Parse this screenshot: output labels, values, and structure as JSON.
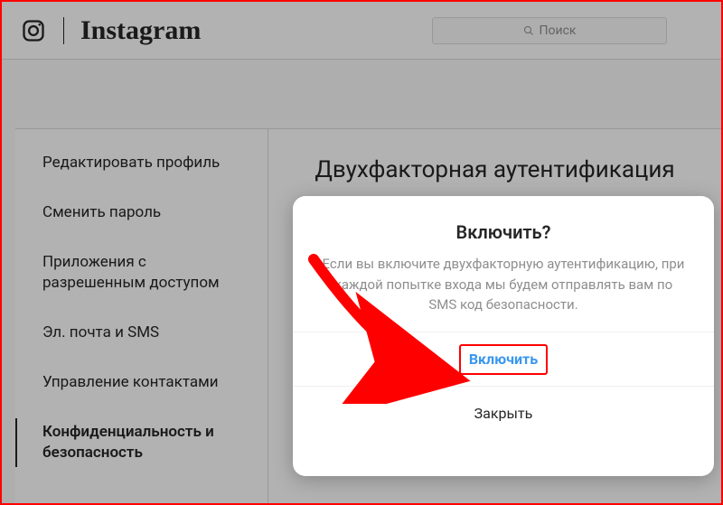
{
  "header": {
    "wordmark": "Instagram",
    "search_placeholder": "Поиск"
  },
  "sidebar": {
    "items": [
      {
        "label": "Редактировать профиль"
      },
      {
        "label": "Сменить пароль"
      },
      {
        "label": "Приложения с разрешенным доступом"
      },
      {
        "label": "Эл. почта и SMS"
      },
      {
        "label": "Управление контактами"
      },
      {
        "label": "Конфиденциальность и безопасность"
      }
    ],
    "active_index": 5
  },
  "content": {
    "page_title": "Двухфакторная аутентификация"
  },
  "modal": {
    "title": "Включить?",
    "description": "Если вы включите двухфакторную аутентификацию, при каждой попытке входа мы будем отправлять вам по SMS код безопасности.",
    "primary_label": "Включить",
    "secondary_label": "Закрыть"
  }
}
